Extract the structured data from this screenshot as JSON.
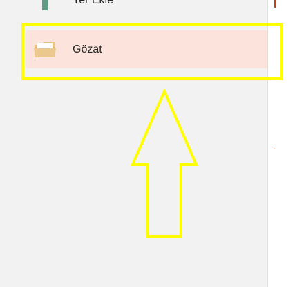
{
  "nav": {
    "items": [
      {
        "label": "Yer Ekle",
        "icon": "plus-icon"
      },
      {
        "label": "Gözat",
        "icon": "folder-icon",
        "selected": true
      }
    ]
  },
  "colors": {
    "pane_background": "#f2f2f2",
    "selected_background": "#fce4dc",
    "plus_icon": "#5f9c84",
    "folder_icon": "#e8c07d",
    "accent": "#c43e1c",
    "annotation": "#ffff00"
  }
}
